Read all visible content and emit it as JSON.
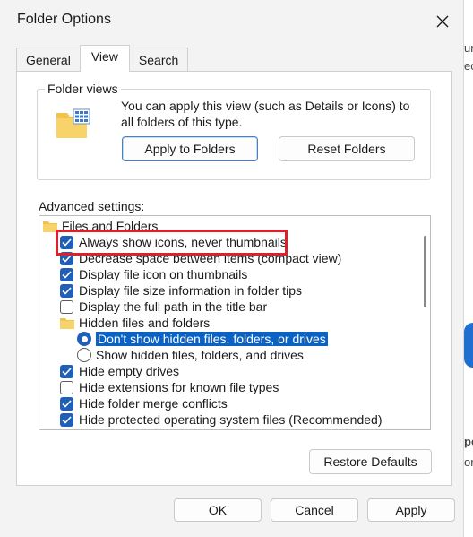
{
  "dialog": {
    "title": "Folder Options",
    "close_icon": "close-icon"
  },
  "tabs": [
    {
      "label": "General",
      "active": false
    },
    {
      "label": "View",
      "active": true
    },
    {
      "label": "Search",
      "active": false
    }
  ],
  "folder_views": {
    "label": "Folder views",
    "description": "You can apply this view (such as Details or Icons) to all folders of this type.",
    "apply_button": "Apply to Folders",
    "reset_button": "Reset Folders"
  },
  "advanced": {
    "label": "Advanced settings:",
    "items": [
      {
        "type": "folder",
        "label": "Files and Folders"
      },
      {
        "type": "checkbox",
        "checked": true,
        "label": "Always show icons, never thumbnails",
        "indent": 1
      },
      {
        "type": "checkbox",
        "checked": true,
        "label": "Decrease space between items (compact view)",
        "indent": 1
      },
      {
        "type": "checkbox",
        "checked": true,
        "label": "Display file icon on thumbnails",
        "indent": 1
      },
      {
        "type": "checkbox",
        "checked": true,
        "label": "Display file size information in folder tips",
        "indent": 1
      },
      {
        "type": "checkbox",
        "checked": false,
        "label": "Display the full path in the title bar",
        "indent": 1
      },
      {
        "type": "folder",
        "label": "Hidden files and folders",
        "indent": 1
      },
      {
        "type": "radio",
        "selected": true,
        "label": "Don't show hidden files, folders, or drives",
        "indent": 2
      },
      {
        "type": "radio",
        "selected": false,
        "label": "Show hidden files, folders, and drives",
        "indent": 2
      },
      {
        "type": "checkbox",
        "checked": true,
        "label": "Hide empty drives",
        "indent": 1
      },
      {
        "type": "checkbox",
        "checked": false,
        "label": "Hide extensions for known file types",
        "indent": 1
      },
      {
        "type": "checkbox",
        "checked": true,
        "label": "Hide folder merge conflicts",
        "indent": 1
      },
      {
        "type": "checkbox",
        "checked": true,
        "label": "Hide protected operating system files (Recommended)",
        "indent": 1
      }
    ]
  },
  "restore_defaults": "Restore Defaults",
  "footer": {
    "ok": "OK",
    "cancel": "Cancel",
    "apply": "Apply"
  },
  "colors": {
    "accent": "#1f5fb8",
    "selection": "#0a62c4",
    "annotation_red": "#e01f2b"
  },
  "backdrop_fragments": [
    "ur",
    "ec",
    "pe",
    "or"
  ]
}
